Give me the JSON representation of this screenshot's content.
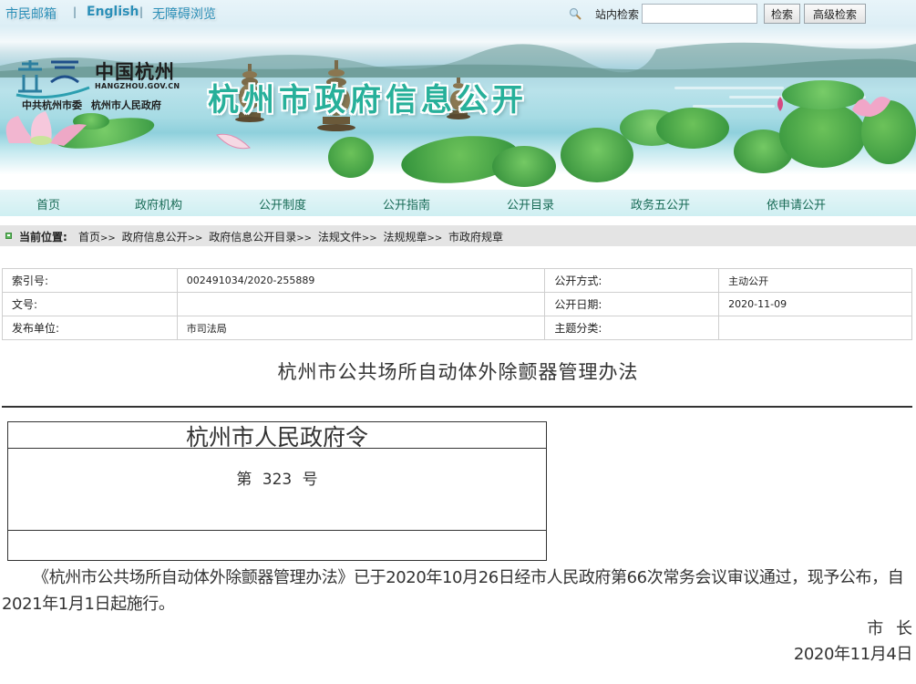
{
  "topbar": {
    "links": [
      "市民邮箱",
      "English",
      "无障碍浏览"
    ],
    "separator": "|",
    "search_label": "站内检索",
    "search_value": "",
    "search_button": "检索",
    "advanced_search_button": "高级检索"
  },
  "banner": {
    "logo_cn": "中国杭州",
    "logo_en": "HANGZHOU.GOV.CN",
    "logo_sub": "中共杭州市委 杭州市人民政府",
    "site_title": "杭州市政府信息公开"
  },
  "nav": {
    "items": [
      "首页",
      "政府机构",
      "公开制度",
      "公开指南",
      "公开目录",
      "政务五公开",
      "依申请公开"
    ]
  },
  "breadcrumb": {
    "title": "当前位置:",
    "items": [
      "首页",
      "政府信息公开",
      "政府信息公开目录",
      "法规文件",
      "法规规章",
      "市政府规章"
    ],
    "separator": ">>"
  },
  "meta": {
    "rows": [
      {
        "k1": "索引号:",
        "v1": "002491034/2020-255889",
        "k2": "公开方式:",
        "v2": "主动公开"
      },
      {
        "k1": "文号:",
        "v1": "",
        "k2": "公开日期:",
        "v2": "2020-11-09"
      },
      {
        "k1": "发布单位:",
        "v1": "市司法局",
        "k2": "主题分类:",
        "v2": ""
      }
    ]
  },
  "document": {
    "title": "杭州市公共场所自动体外除颤器管理办法",
    "order_heading": "杭州市人民政府令",
    "order_number": "第 323 号",
    "body": "《杭州市公共场所自动体外除颤器管理办法》已于2020年10月26日经市人民政府第66次常务会议审议通过，现予公布，自2021年1月1日起施行。",
    "signature_title": "市 长",
    "signature_date": "2020年11月4日"
  },
  "colors": {
    "title_green": "#27b09a",
    "nav_text": "#176a55",
    "link_blue": "#2a8fb8",
    "crumb_bg": "#e4e4e4"
  }
}
